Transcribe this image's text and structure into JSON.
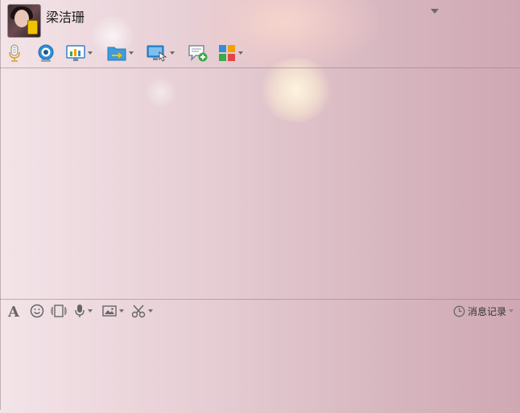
{
  "contact": {
    "name": "梁洁珊"
  },
  "toolbar": {
    "items": [
      {
        "icon": "microphone-icon"
      },
      {
        "icon": "webcam-icon"
      },
      {
        "icon": "screen-share-icon",
        "has_dropdown": true
      },
      {
        "icon": "file-transfer-icon",
        "has_dropdown": true
      },
      {
        "icon": "remote-desktop-icon",
        "has_dropdown": true
      },
      {
        "icon": "new-message-icon"
      },
      {
        "icon": "apps-icon",
        "has_dropdown": true
      }
    ]
  },
  "input_toolbar": {
    "items": [
      {
        "icon": "font-icon"
      },
      {
        "icon": "emoji-icon"
      },
      {
        "icon": "shake-window-icon"
      },
      {
        "icon": "voice-message-icon",
        "has_dropdown": true
      },
      {
        "icon": "image-icon",
        "has_dropdown": true
      },
      {
        "icon": "screenshot-scissors-icon",
        "has_dropdown": true
      }
    ],
    "history_label": "消息记录",
    "history_icon": "clock-icon"
  },
  "colors": {
    "background_left": "#f3e4e8",
    "background_right": "#cfa8b3",
    "divider": "#a07882",
    "icon_blue": "#2f8fd8",
    "icon_green": "#3ca94a",
    "icon_yellow": "#f2c300"
  }
}
